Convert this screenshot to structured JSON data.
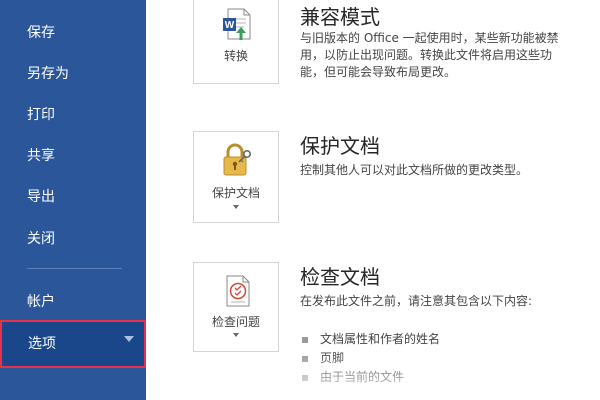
{
  "sidebar": {
    "items": [
      {
        "id": "save",
        "label": "保存"
      },
      {
        "id": "saveas",
        "label": "另存为"
      },
      {
        "id": "print",
        "label": "打印"
      },
      {
        "id": "share",
        "label": "共享"
      },
      {
        "id": "export",
        "label": "导出"
      },
      {
        "id": "close",
        "label": "关闭"
      },
      {
        "id": "account",
        "label": "帐户"
      }
    ],
    "options_label": "选项",
    "highlight_color": "#e8304a",
    "background_color": "#2b579a"
  },
  "sections": {
    "compat": {
      "title": "兼容模式",
      "description": "与旧版本的 Office 一起使用时，某些新功能被禁用，以防止出现问题。转换此文件将启用这些功能，但可能会导致布局更改。",
      "button_label": "转换",
      "icon": "word-convert-icon"
    },
    "protect": {
      "title": "保护文档",
      "description": "控制其他人可以对此文档所做的更改类型。",
      "button_label": "保护文档",
      "icon": "lock-key-icon"
    },
    "inspect": {
      "title": "检查文档",
      "description": "在发布此文件之前，请注意其包含以下内容:",
      "button_label": "检查问题",
      "icon": "document-checklist-icon",
      "bullets": [
        "文档属性和作者的姓名",
        "页脚",
        "由于当前的文件"
      ]
    }
  }
}
